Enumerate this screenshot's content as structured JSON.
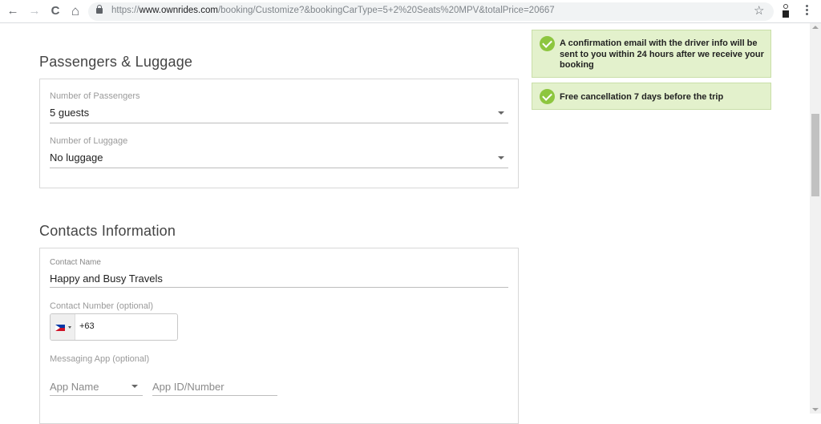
{
  "browser": {
    "url_prefix": "https://",
    "url_domain": "www.ownrides.com",
    "url_path": "/booking/Customize?&bookingCarType=5+2%20Seats%20MPV&totalPrice=20667",
    "back_icon": "←",
    "forward_icon": "→",
    "reload_icon": "C",
    "home_icon": "⌂",
    "star_icon": "☆"
  },
  "passengers_section": {
    "title": "Passengers & Luggage",
    "passengers": {
      "label": "Number of Passengers",
      "value": "5 guests"
    },
    "luggage": {
      "label": "Number of Luggage",
      "value": "No luggage"
    }
  },
  "contacts_section": {
    "title": "Contacts Information",
    "contact_name": {
      "label": "Contact Name",
      "value": "Happy and Busy Travels"
    },
    "contact_number": {
      "label": "Contact Number (optional)",
      "country": "Philippines",
      "value": "+63"
    },
    "messaging_app": {
      "label": "Messaging App (optional)",
      "app_name_placeholder": "App Name",
      "app_id_placeholder": "App ID/Number"
    }
  },
  "notices": [
    {
      "icon": "check-circle-icon",
      "text": "A confirmation email with the driver info will be sent to you within 24 hours after we receive your booking"
    },
    {
      "icon": "check-circle-icon",
      "text": "Free cancellation 7 days before the trip"
    }
  ],
  "colors": {
    "notice_bg": "#e3f1cc",
    "check_green": "#8dc63f"
  }
}
